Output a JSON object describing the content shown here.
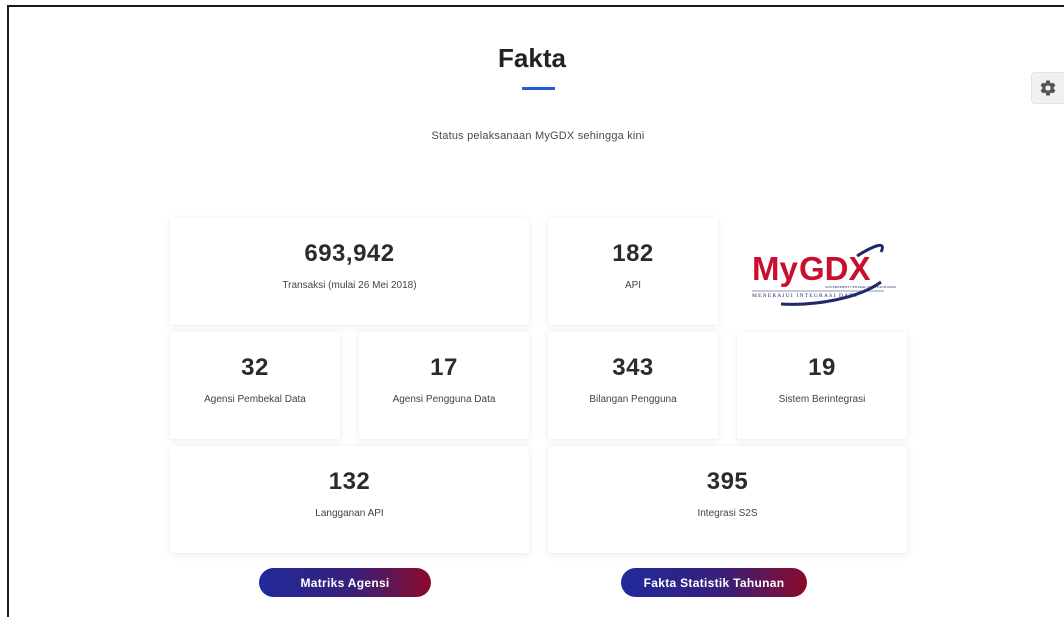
{
  "page": {
    "title": "Fakta",
    "subtitle": "Status pelaksanaan MyGDX sehingga kini"
  },
  "stats": {
    "transaksi": {
      "value": "693,942",
      "label": "Transaksi (mulai 26 Mei 2018)"
    },
    "api": {
      "value": "182",
      "label": "API"
    },
    "agensi_pembekal": {
      "value": "32",
      "label": "Agensi Pembekal Data"
    },
    "agensi_pengguna": {
      "value": "17",
      "label": "Agensi Pengguna Data"
    },
    "bilangan_pengguna": {
      "value": "343",
      "label": "Bilangan Pengguna"
    },
    "sistem_berintegrasi": {
      "value": "19",
      "label": "Sistem Berintegrasi"
    },
    "langganan_api": {
      "value": "132",
      "label": "Langganan API"
    },
    "integrasi_s2s": {
      "value": "395",
      "label": "Integrasi S2S"
    }
  },
  "logo": {
    "text_my": "My",
    "text_gdx": "GDX",
    "tagline_small": "GOVERNMENT CENTRAL DATA EXCHANGE",
    "tagline": "MENERAJUI INTEGRASI DATA"
  },
  "buttons": {
    "matriks_agensi": "Matriks Agensi",
    "fakta_statistik": "Fakta Statistik Tahunan"
  },
  "colors": {
    "accent": "#1b5fd6",
    "logo_red": "#c8102e",
    "logo_navy": "#1f2a6b",
    "button_start": "#1f2a9a",
    "button_end": "#8a0a2a"
  },
  "icons": {
    "settings": "gear-icon"
  }
}
